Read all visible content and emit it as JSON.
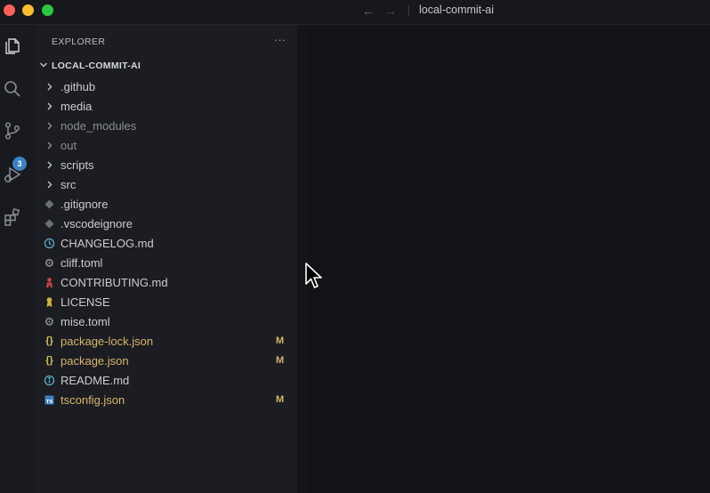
{
  "window": {
    "title": "local-commit-ai",
    "back_icon": "←",
    "forward_icon": "→"
  },
  "activity_bar": {
    "source_control_badge": "3"
  },
  "explorer": {
    "title": "EXPLORER",
    "more_label": "···",
    "root_label": "LOCAL-COMMIT-AI",
    "items": [
      {
        "label": "github",
        "kind": "folder"
      },
      {
        "label": "media",
        "kind": "folder"
      },
      {
        "label": "node_modules",
        "kind": "folder"
      },
      {
        "label": "out",
        "kind": "folder"
      },
      {
        "label": "scripts",
        "kind": "folder"
      },
      {
        "label": "src",
        "kind": "folder"
      },
      {
        "label": ".gitignore",
        "kind": "file"
      },
      {
        "label": ".vscodeignore",
        "kind": "file"
      },
      {
        "label": "CHANGELOG.md",
        "kind": "file"
      },
      {
        "label": "cliff.toml",
        "kind": "file"
      },
      {
        "label": "CONTRIBUTING.md",
        "kind": "file"
      },
      {
        "label": "LICENSE",
        "kind": "file"
      },
      {
        "label": "mise.toml",
        "kind": "file"
      },
      {
        "label": "package-lock.json",
        "kind": "file",
        "status": "M"
      },
      {
        "label": "package.json",
        "kind": "file",
        "status": "M"
      },
      {
        "label": "README.md",
        "kind": "file"
      },
      {
        "label": "tsconfig.json",
        "kind": "file",
        "status": "M"
      }
    ]
  },
  "colors": {
    "modified": "#d8b56a",
    "badge": "#3b82c4",
    "background": "#181a1f"
  }
}
